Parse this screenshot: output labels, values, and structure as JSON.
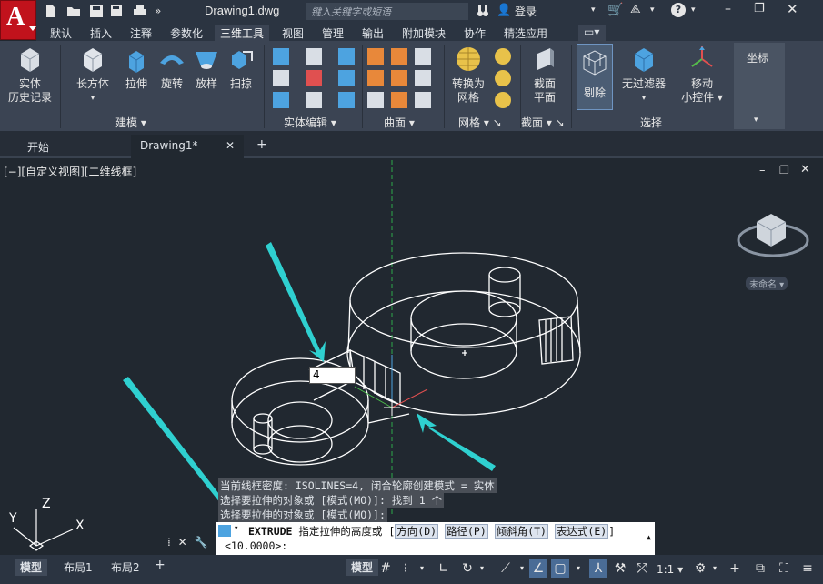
{
  "app": {
    "logo_letter": "A"
  },
  "title": {
    "document": "Drawing1.dwg"
  },
  "search": {
    "placeholder": "键入关键字或短语"
  },
  "login": {
    "label": "登录"
  },
  "ribbon_tabs": [
    "默认",
    "插入",
    "注释",
    "参数化",
    "三维工具",
    "视图",
    "管理",
    "输出",
    "附加模块",
    "协作",
    "精选应用"
  ],
  "active_tab": "三维工具",
  "ribbon": {
    "solid_history": [
      "实体",
      "历史记录"
    ],
    "modeling_buttons": [
      "长方体",
      "拉伸",
      "旋转",
      "放样",
      "扫掠"
    ],
    "modeling_group": "建模",
    "solid_edit_group": "实体编辑",
    "surface_group": "曲面",
    "convert_mesh": [
      "转换为",
      "网格"
    ],
    "mesh_group": "网格",
    "section_plane": [
      "截面",
      "平面"
    ],
    "section_group": "截面",
    "cull": "剔除",
    "no_filter": "无过滤器",
    "move_gizmo": [
      "移动",
      "小控件"
    ],
    "select_group": "选择",
    "coord": "坐标"
  },
  "file_tabs": {
    "start": "开始",
    "drawing": "Drawing1*",
    "add": "+"
  },
  "viewport": {
    "label": "[−][自定义视图][二维线框]",
    "viewcube_label": "未命名",
    "dyn_input_value": "4"
  },
  "command": {
    "history": [
      "当前线框密度:  ISOLINES=4, 闭合轮廓创建模式 = 实体",
      "选择要拉伸的对象或 [模式(MO)]: 找到 1 个",
      "选择要拉伸的对象或 [模式(MO)]:"
    ],
    "name": "EXTRUDE",
    "prompt": "指定拉伸的高度或",
    "options": [
      "方向(D)",
      "路径(P)",
      "倾斜角(T)",
      "表达式(E)"
    ],
    "default_value": "<10.0000>:"
  },
  "status": {
    "layout_tabs": [
      "模型",
      "布局1",
      "布局2"
    ],
    "scale": "1:1"
  },
  "colors": {
    "accent": "#2fd0d0",
    "logo": "#c1121c",
    "ribbon": "#3b4453"
  }
}
